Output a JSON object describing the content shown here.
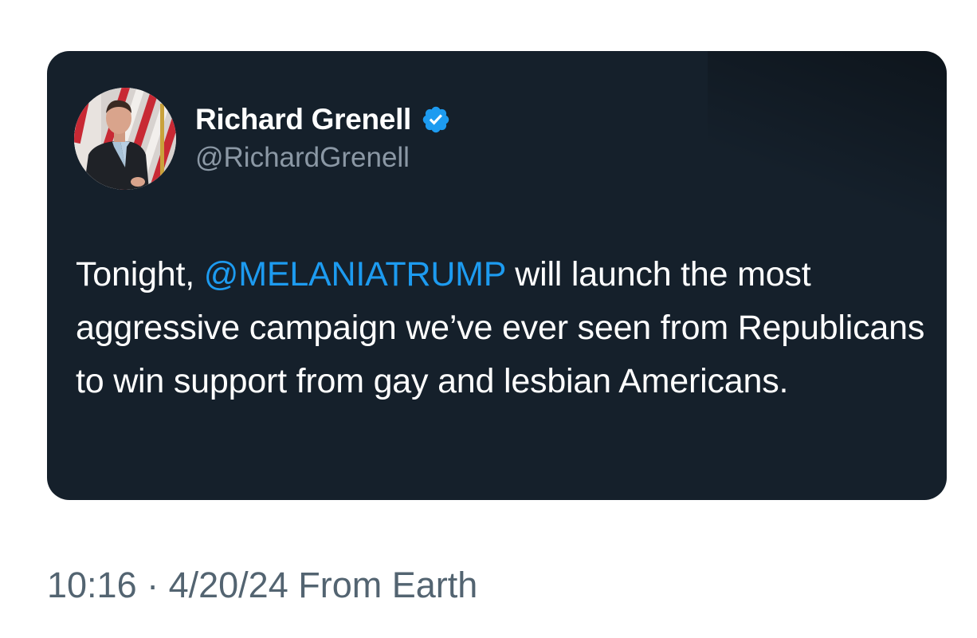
{
  "tweet": {
    "author": {
      "display_name": "Richard Grenell",
      "handle": "@RichardGrenell",
      "verified": true,
      "verified_color": "#1d9bf0",
      "avatar_icon": "profile-photo-man-suit-flag"
    },
    "body": {
      "prefix": "Tonight, ",
      "mention": "@MELANIATRUMP",
      "suffix": " will launch the most aggressive campaign we’ve ever seen from Republicans to win support from gay and lesbian Americans."
    },
    "colors": {
      "card_background": "#15202b",
      "mention": "#1d9bf0",
      "handle": "#8b98a5"
    }
  },
  "meta": {
    "timestamp": "10:16 · 4/20/24 From Earth"
  }
}
